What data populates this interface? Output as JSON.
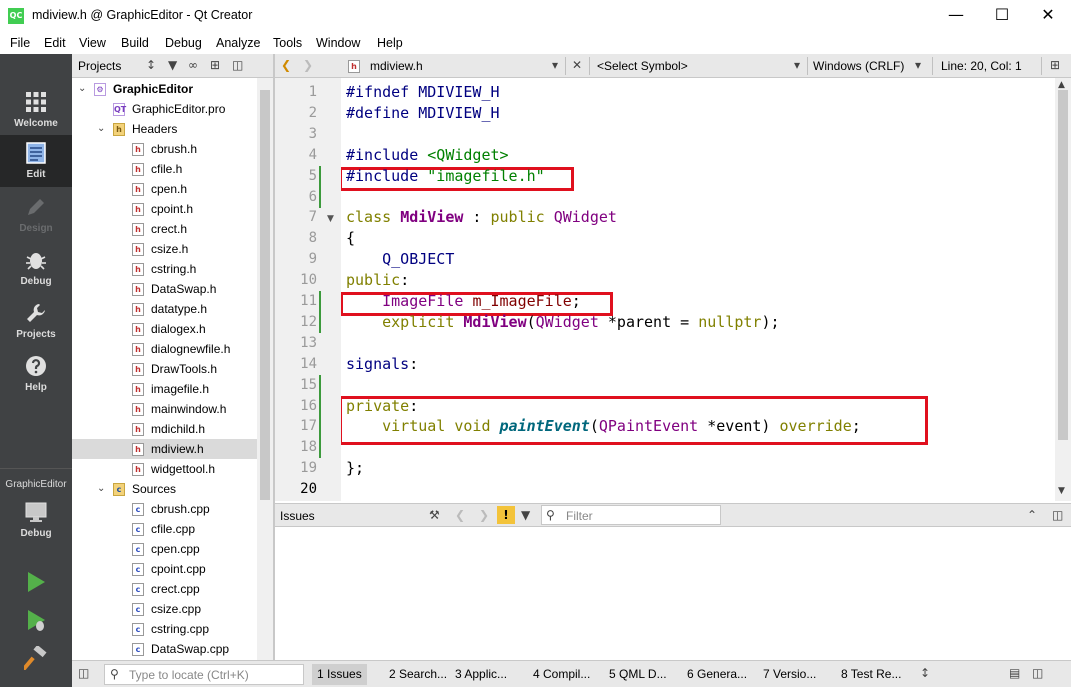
{
  "window": {
    "title": "mdiview.h @ GraphicEditor - Qt Creator",
    "app_icon": "QC",
    "controls": [
      "minimize-icon",
      "maximize-icon",
      "close-icon"
    ]
  },
  "menu": [
    "File",
    "Edit",
    "View",
    "Build",
    "Debug",
    "Analyze",
    "Tools",
    "Window",
    "Help"
  ],
  "modes": [
    {
      "label": "Welcome",
      "icon": "grid-icon"
    },
    {
      "label": "Edit",
      "icon": "document-icon"
    },
    {
      "label": "Design",
      "icon": "pencil-icon"
    },
    {
      "label": "Debug",
      "icon": "bug-icon"
    },
    {
      "label": "Projects",
      "icon": "wrench-icon"
    },
    {
      "label": "Help",
      "icon": "question-icon"
    }
  ],
  "kit": {
    "project": "GraphicEditor",
    "config": "Debug"
  },
  "projects": {
    "title": "Projects",
    "tree": [
      {
        "label": "GraphicEditor",
        "kind": "project",
        "level": 0
      },
      {
        "label": "GraphicEditor.pro",
        "kind": "pro",
        "level": 1
      },
      {
        "label": "Headers",
        "kind": "folder",
        "level": 1
      },
      {
        "label": "cbrush.h",
        "kind": "h",
        "level": 2
      },
      {
        "label": "cfile.h",
        "kind": "h",
        "level": 2
      },
      {
        "label": "cpen.h",
        "kind": "h",
        "level": 2
      },
      {
        "label": "cpoint.h",
        "kind": "h",
        "level": 2
      },
      {
        "label": "crect.h",
        "kind": "h",
        "level": 2
      },
      {
        "label": "csize.h",
        "kind": "h",
        "level": 2
      },
      {
        "label": "cstring.h",
        "kind": "h",
        "level": 2
      },
      {
        "label": "DataSwap.h",
        "kind": "h",
        "level": 2
      },
      {
        "label": "datatype.h",
        "kind": "h",
        "level": 2
      },
      {
        "label": "dialogex.h",
        "kind": "h",
        "level": 2
      },
      {
        "label": "dialognewfile.h",
        "kind": "h",
        "level": 2
      },
      {
        "label": "DrawTools.h",
        "kind": "h",
        "level": 2
      },
      {
        "label": "imagefile.h",
        "kind": "h",
        "level": 2
      },
      {
        "label": "mainwindow.h",
        "kind": "h",
        "level": 2
      },
      {
        "label": "mdichild.h",
        "kind": "h",
        "level": 2
      },
      {
        "label": "mdiview.h",
        "kind": "h",
        "level": 2,
        "selected": true
      },
      {
        "label": "widgettool.h",
        "kind": "h",
        "level": 2
      },
      {
        "label": "Sources",
        "kind": "folder-src",
        "level": 1
      },
      {
        "label": "cbrush.cpp",
        "kind": "cpp",
        "level": 2
      },
      {
        "label": "cfile.cpp",
        "kind": "cpp",
        "level": 2
      },
      {
        "label": "cpen.cpp",
        "kind": "cpp",
        "level": 2
      },
      {
        "label": "cpoint.cpp",
        "kind": "cpp",
        "level": 2
      },
      {
        "label": "crect.cpp",
        "kind": "cpp",
        "level": 2
      },
      {
        "label": "csize.cpp",
        "kind": "cpp",
        "level": 2
      },
      {
        "label": "cstring.cpp",
        "kind": "cpp",
        "level": 2
      },
      {
        "label": "DataSwap.cpp",
        "kind": "cpp",
        "level": 2
      }
    ]
  },
  "editor": {
    "file": "mdiview.h",
    "symbol": "<Select Symbol>",
    "line_ending": "Windows (CRLF)",
    "position": "Line: 20, Col: 1",
    "current_line": 20,
    "lines": [
      {
        "n": 1,
        "html": "<span class=\"pp\">#ifndef MDIVIEW_H</span>"
      },
      {
        "n": 2,
        "html": "<span class=\"pp\">#define MDIVIEW_H</span>"
      },
      {
        "n": 3,
        "html": ""
      },
      {
        "n": 4,
        "html": "<span class=\"pp\">#include</span> <span class=\"inc\">&lt;QWidget&gt;</span>"
      },
      {
        "n": 5,
        "html": "<span class=\"pp\">#include</span> <span class=\"inc\">\"imagefile.h\"</span>"
      },
      {
        "n": 6,
        "html": ""
      },
      {
        "n": 7,
        "html": "<span class=\"kw\">class</span> <span class=\"cls\">MdiView</span> : <span class=\"kw\">public</span> <span class=\"typ\">QWidget</span>"
      },
      {
        "n": 8,
        "html": "{"
      },
      {
        "n": 9,
        "html": "    <span class=\"mac\">Q_OBJECT</span>"
      },
      {
        "n": 10,
        "html": "<span class=\"kw\">public</span>:"
      },
      {
        "n": 11,
        "html": "    <span class=\"typ\">ImageFile</span> <span class=\"fld\">m_ImageFile</span>;"
      },
      {
        "n": 12,
        "html": "    <span class=\"kw\">explicit</span> <span class=\"cls\">MdiView</span>(<span class=\"typ\">QWidget</span> *parent = <span class=\"kw\">nullptr</span>);"
      },
      {
        "n": 13,
        "html": ""
      },
      {
        "n": 14,
        "html": "<span class=\"pp\">signals</span>:"
      },
      {
        "n": 15,
        "html": ""
      },
      {
        "n": 16,
        "html": "<span class=\"kw\">private</span>:"
      },
      {
        "n": 17,
        "html": "    <span class=\"kw\">virtual</span> <span class=\"kw\">void</span> <span class=\"fnv\">paintEvent</span>(<span class=\"typ\">QPaintEvent</span> *event) <span class=\"kw\">override</span>;"
      },
      {
        "n": 18,
        "html": ""
      },
      {
        "n": 19,
        "html": "};"
      },
      {
        "n": 20,
        "html": ""
      }
    ],
    "modified_lines": [
      5,
      6,
      11,
      12,
      15,
      16,
      17,
      18
    ]
  },
  "issues": {
    "title": "Issues",
    "filter_placeholder": "Filter"
  },
  "statusbar": {
    "locator_placeholder": "Type to locate (Ctrl+K)",
    "tabs": [
      "1  Issues",
      "2  Search...",
      "3  Applic...",
      "4  Compil...",
      "5  QML D...",
      "6  Genera...",
      "7  Versio...",
      "8  Test Re..."
    ],
    "active_tab": 0
  },
  "colors": {
    "highlight_box": "#e0101e",
    "modebar": "#404244",
    "modified_marker": "#3c9a3c"
  }
}
